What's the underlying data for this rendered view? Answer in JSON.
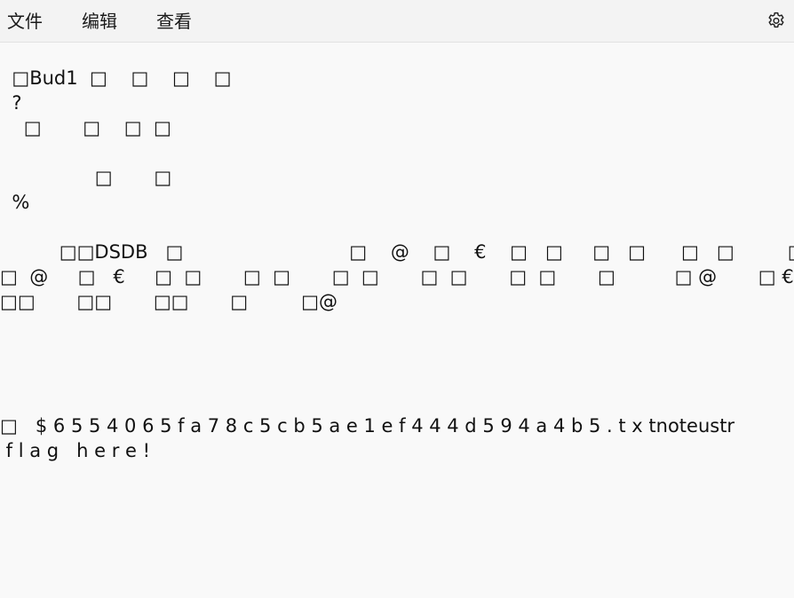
{
  "menu": {
    "file": "文件",
    "edit": "编辑",
    "view": "查看"
  },
  "settings_icon": "gear-icon",
  "document": {
    "lines": [
      "  □Bud1  □    □    □    □",
      "  ?",
      "    □       □    □  □",
      "",
      "                □       □",
      "  %",
      "",
      "          □□DSDB   □                            □    @    □    €    □   □     □   □      □   □         □   □",
      "□  @     □   €     □  □       □  □       □  □       □  □       □  □       □          □ @       □ €      □□        □□",
      "□□       □□       □□       □         □@",
      "",
      "",
      "",
      "",
      "□   $ 6 5 5 4 0 6 5 f a 7 8 c 5 c b 5 a e 1 e f 4 4 4 d 5 9 4 a 4 b 5 . t x tnoteustr",
      " f l a g   h e r e !"
    ]
  }
}
